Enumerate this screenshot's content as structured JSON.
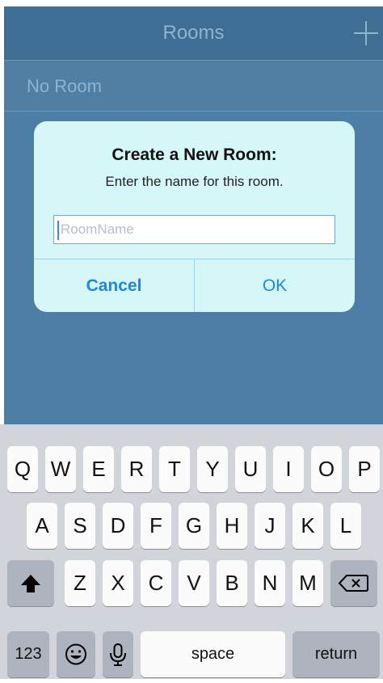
{
  "navbar": {
    "title": "Rooms",
    "add_icon": "plus-icon"
  },
  "list": {
    "items": [
      {
        "label": "No Room"
      }
    ]
  },
  "dialog": {
    "title": "Create a New Room:",
    "message": "Enter the name for this room.",
    "input_placeholder": "RoomName",
    "input_value": "",
    "cancel_label": "Cancel",
    "ok_label": "OK"
  },
  "keyboard": {
    "row1": [
      "Q",
      "W",
      "E",
      "R",
      "T",
      "Y",
      "U",
      "I",
      "O",
      "P"
    ],
    "row2": [
      "A",
      "S",
      "D",
      "F",
      "G",
      "H",
      "J",
      "K",
      "L"
    ],
    "row3": [
      "Z",
      "X",
      "C",
      "V",
      "B",
      "N",
      "M"
    ],
    "numbers_label": "123",
    "space_label": "space",
    "return_label": "return",
    "icons": {
      "shift": "shift-icon",
      "delete": "delete-icon",
      "emoji": "emoji-icon",
      "mic": "microphone-icon"
    }
  },
  "colors": {
    "accent": "#1a88e6",
    "navbar": "#3f6e94",
    "background": "#4d7fa6",
    "dialog": "#d6f7f7"
  }
}
